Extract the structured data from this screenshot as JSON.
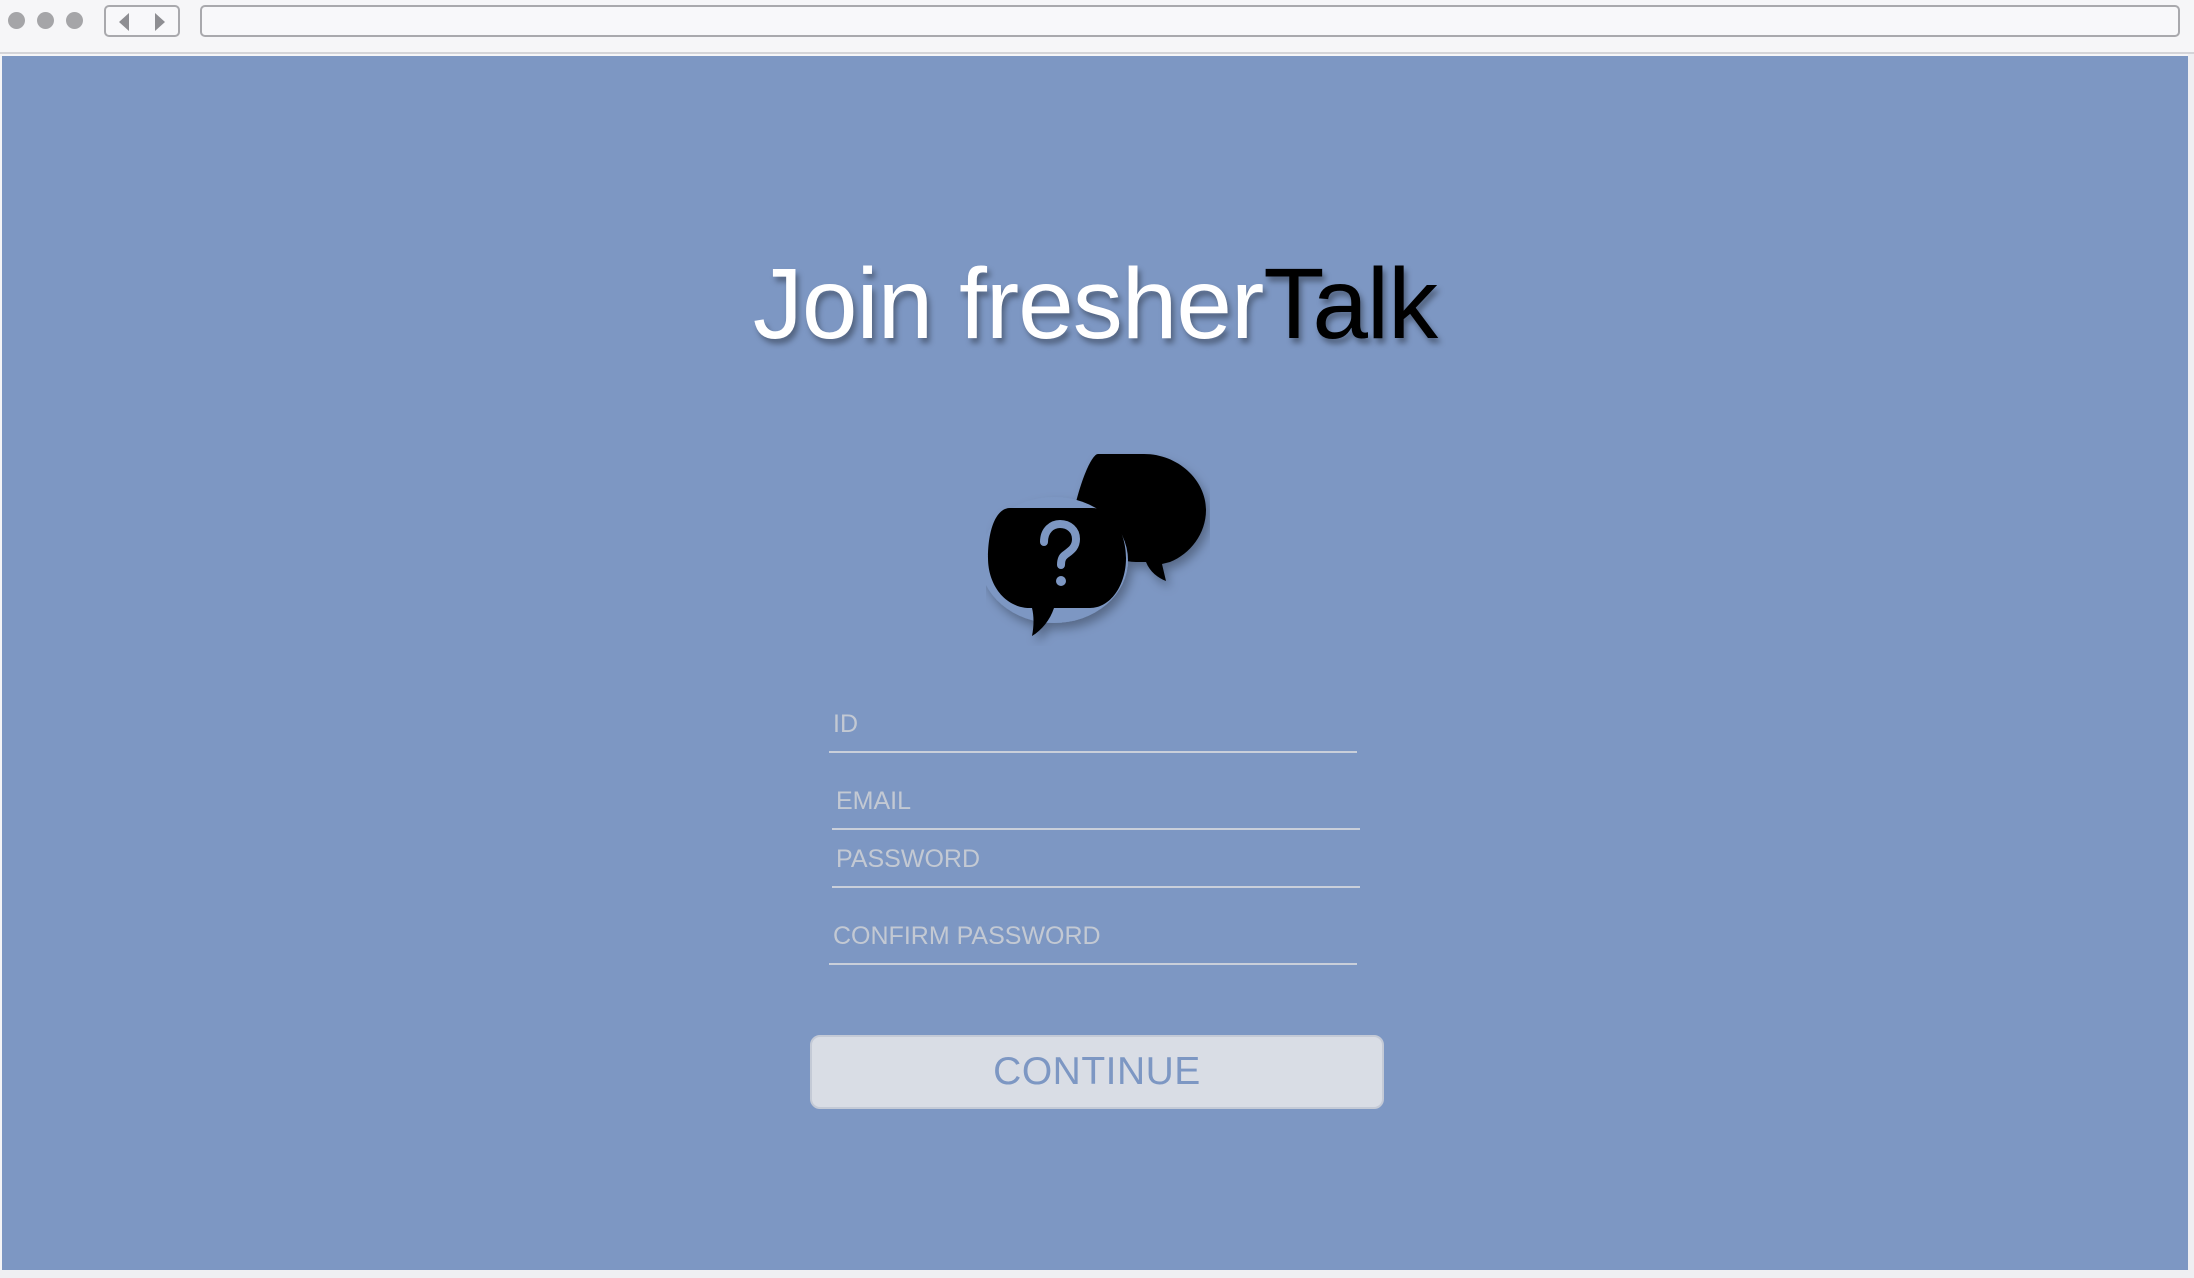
{
  "page": {
    "title_part_a": "Join fresher",
    "title_part_b": "Talk"
  },
  "icons": {
    "logo": "chat-bubbles-question-icon",
    "back": "chevron-left-icon",
    "forward": "chevron-right-icon"
  },
  "form": {
    "id_placeholder": "ID",
    "email_placeholder": "EMAIL",
    "password_placeholder": "PASSWORD",
    "confirm_password_placeholder": "CONFIRM PASSWORD",
    "continue_label": "CONTINUE"
  },
  "colors": {
    "background": "#7d97c3",
    "button_bg": "#d9dde5",
    "title_primary": "#ffffff",
    "title_accent": "#000000"
  }
}
